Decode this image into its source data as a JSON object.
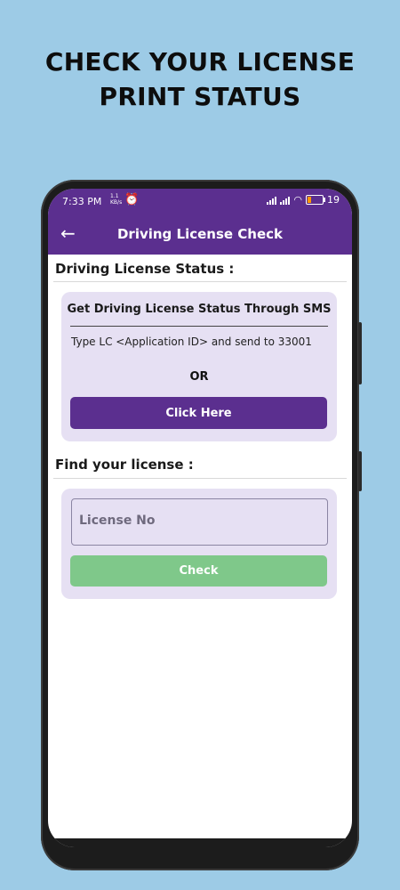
{
  "headline": {
    "line1": "CHECK YOUR LICENSE",
    "line2": "PRINT STATUS"
  },
  "statusbar": {
    "time": "7:33 PM",
    "rate_value": "1.1",
    "rate_unit": "KB/s",
    "battery": "19"
  },
  "appbar": {
    "title": "Driving License Check"
  },
  "status_section": {
    "title": "Driving License Status :",
    "card_heading": "Get Driving License Status Through SMS",
    "instruction": "Type   LC <Application ID>  and send to 33001",
    "or_label": "OR",
    "click_label": "Click Here"
  },
  "find_section": {
    "title": "Find your license :",
    "license_placeholder": "License No",
    "check_label": "Check"
  },
  "colors": {
    "primary": "#5b2f8f",
    "card": "#e6e0f3",
    "check_button": "#7fc88a",
    "background": "#9dcbe6"
  }
}
